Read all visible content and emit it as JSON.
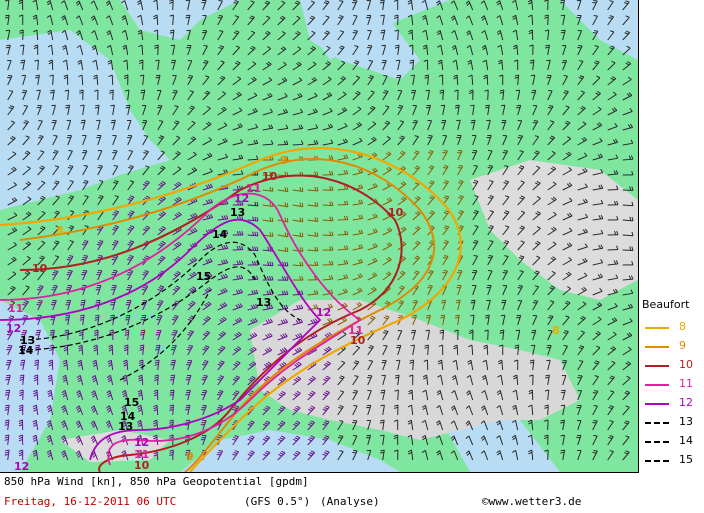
{
  "map": {
    "contour_labels": [
      {
        "text": "8",
        "color": "#f0a800"
      },
      {
        "text": "9",
        "color": "#e08a00"
      },
      {
        "text": "10",
        "color": "#b02020"
      },
      {
        "text": "11",
        "color": "#e020a0"
      },
      {
        "text": "12",
        "color": "#b000c0"
      },
      {
        "text": "13",
        "color": "#000000"
      },
      {
        "text": "14",
        "color": "#000000"
      },
      {
        "text": "15",
        "color": "#000000"
      }
    ]
  },
  "legend": {
    "title": "Beaufort",
    "items": [
      {
        "value": "8",
        "color": "#f0a800",
        "dashed": false
      },
      {
        "value": "9",
        "color": "#e08a00",
        "dashed": false
      },
      {
        "value": "10",
        "color": "#b02020",
        "dashed": false
      },
      {
        "value": "11",
        "color": "#e020a0",
        "dashed": false
      },
      {
        "value": "12",
        "color": "#b000c0",
        "dashed": false
      },
      {
        "value": "13",
        "color": "#000000",
        "dashed": true
      },
      {
        "value": "14",
        "color": "#000000",
        "dashed": true
      },
      {
        "value": "15",
        "color": "#000000",
        "dashed": true
      }
    ]
  },
  "footer": {
    "line1": "850 hPa Wind [kn], 850 hPa Geopotential [gpdm]",
    "date": "Freitag, 16-12-2011  06 UTC",
    "model": "(GFS 0.5°)",
    "mode": "(Analyse)",
    "credit": "©www.wetter3.de"
  },
  "colors": {
    "land": "#7fe6a0",
    "sea": "#b8dcf4",
    "mountains": "#d8d8d8",
    "barb_default": "#2a2a2a",
    "barb_strong": "#6a1090",
    "barb_orange": "#8a5a00"
  }
}
